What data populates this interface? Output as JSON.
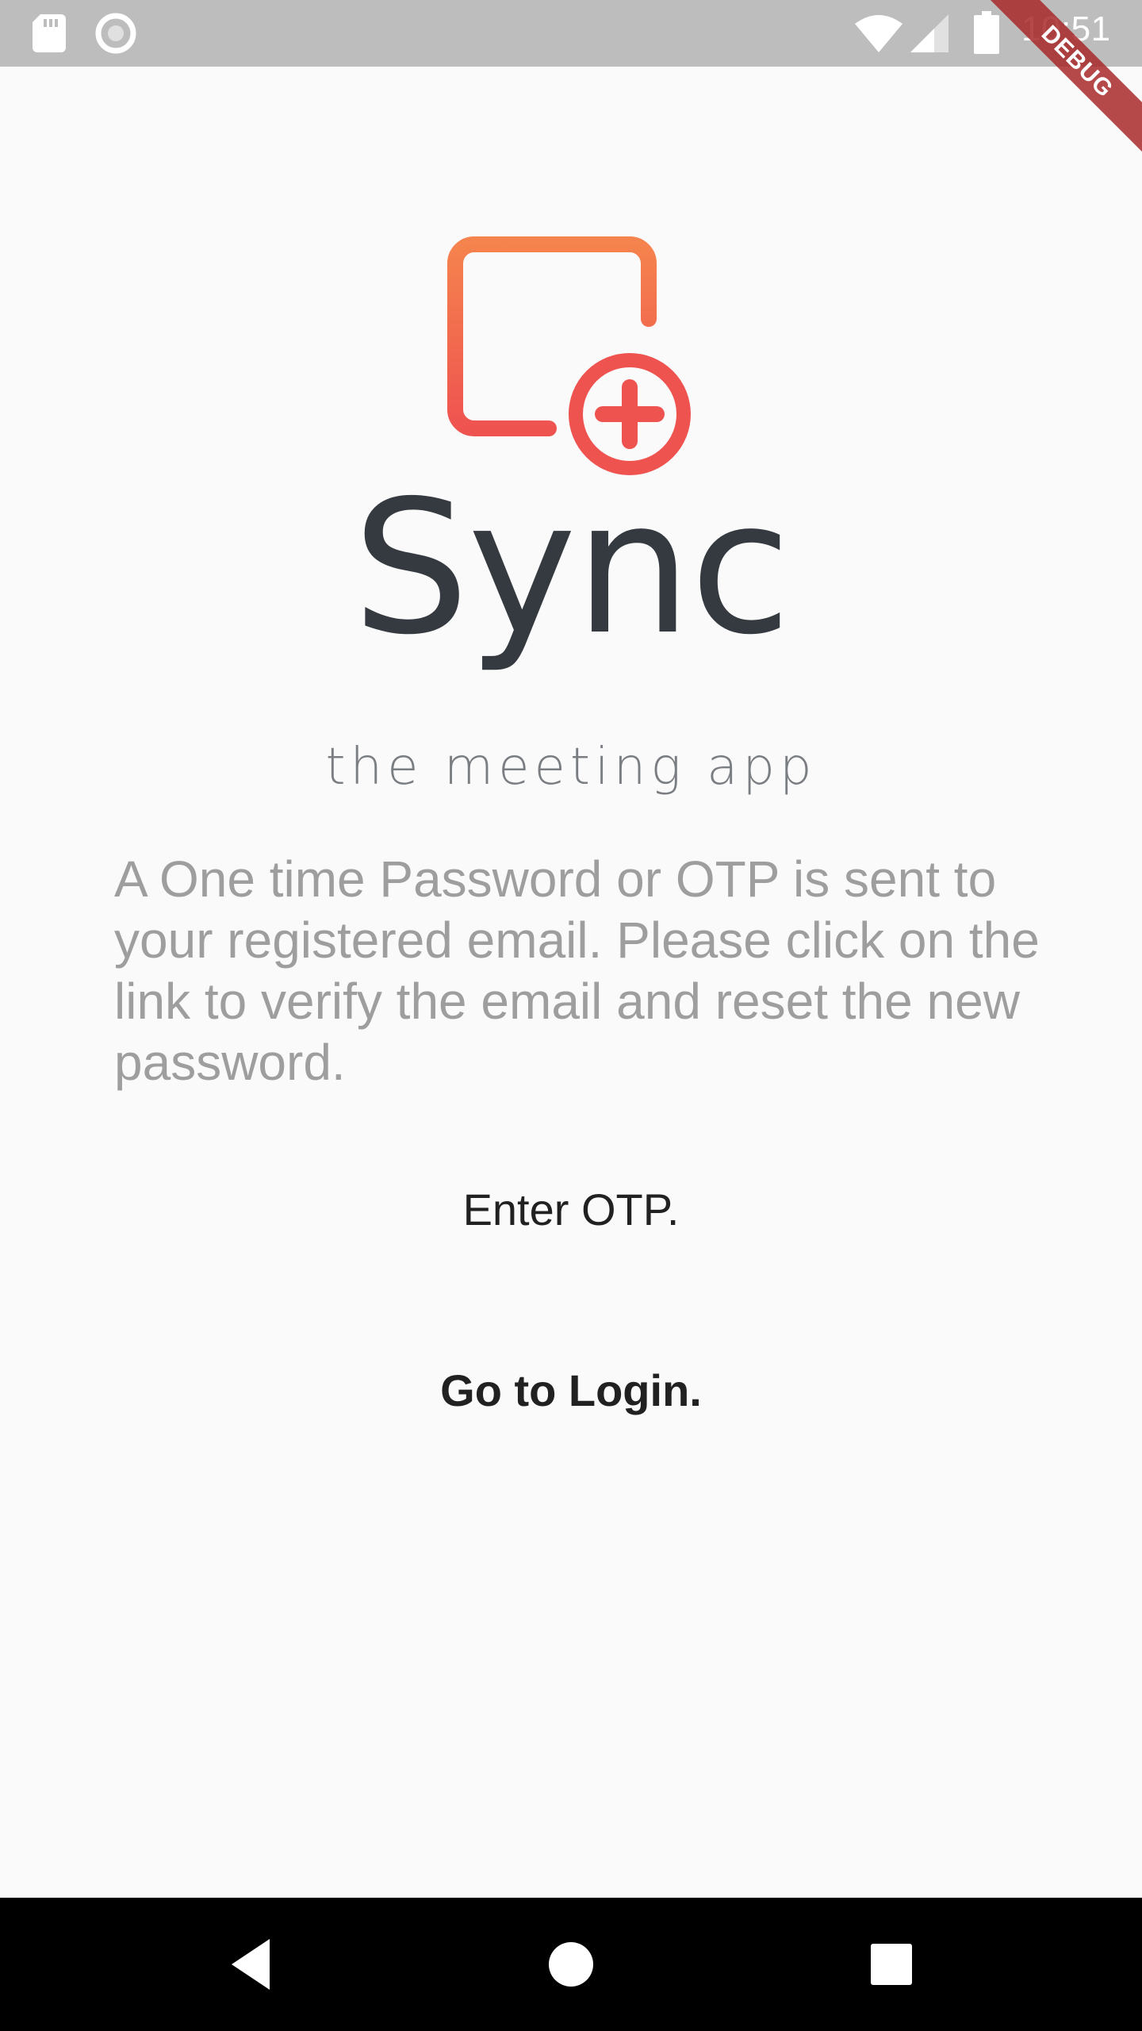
{
  "status_bar": {
    "time": "10:51",
    "icons": [
      "sd-card-icon",
      "circle-notification-icon",
      "wifi-icon",
      "cell-signal-icon",
      "battery-icon"
    ]
  },
  "debug_banner": {
    "label": "DEBUG"
  },
  "app": {
    "brand_name": "Sync",
    "tagline": "the meeting app",
    "logo_icon": "calendar-add-icon",
    "colors": {
      "logo_gradient_start": "#F5834D",
      "logo_gradient_end": "#EF5350",
      "brand_text": "#343A40",
      "info_text": "#9E9E9E",
      "background": "#FAFAFA"
    }
  },
  "content": {
    "info_text": "A One time Password or OTP is sent to your registered email. Please click on the link to verify the email and reset the new password.",
    "otp_placeholder": "Enter OTP.",
    "login_link": "Go to Login."
  },
  "nav_bar": {
    "buttons": [
      "back-icon",
      "home-icon",
      "recents-icon"
    ]
  }
}
